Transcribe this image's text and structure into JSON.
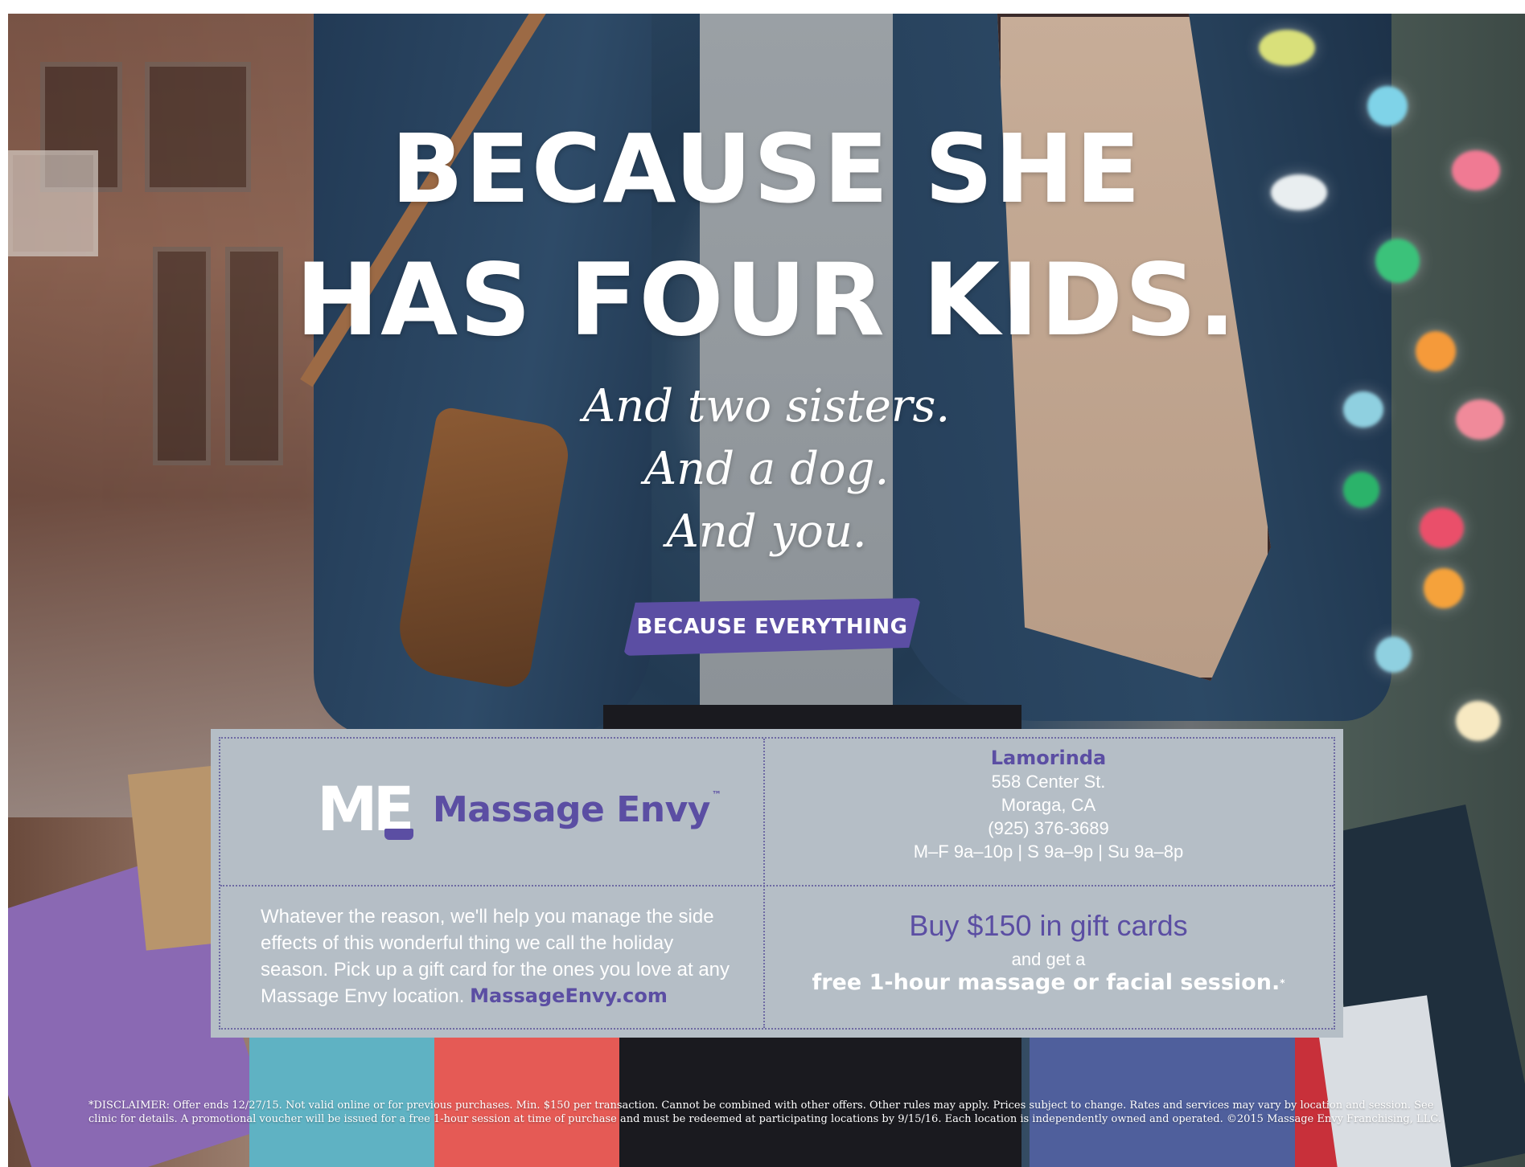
{
  "headline": {
    "line1": "BECAUSE SHE",
    "line2": "HAS FOUR KIDS."
  },
  "subhead": {
    "line1": "And two sisters.",
    "line2": "And a dog.",
    "line3": "And you."
  },
  "banner": {
    "text": "BECAUSE EVERYTHING"
  },
  "logo": {
    "mark": "ME",
    "brand": "Massage Envy",
    "trademark": "™"
  },
  "location": {
    "name": "Lamorinda",
    "street": "558 Center St.",
    "city": "Moraga, CA",
    "phone": "(925) 376-3689",
    "hours": "M–F 9a–10p | S 9a–9p | Su 9a–8p"
  },
  "description": {
    "text": "Whatever the reason, we'll help you manage the side effects of this wonderful thing we call the holiday season. Pick up a gift card for the ones you love at any Massage Envy location.",
    "link": "MassageEnvy.com"
  },
  "offer": {
    "headline": "Buy $150 in gift cards",
    "connector": "and get a",
    "reward": "free 1-hour massage or facial session.",
    "asterisk": "*"
  },
  "disclaimer": {
    "text": "*DISCLAIMER: Offer ends 12/27/15. Not valid online or for previous purchases. Min. $150 per transaction. Cannot be combined with other offers. Other rules may apply. Prices subject to change. Rates and services may vary by location and session. See clinic for details. A promotional voucher will be issued for a free 1-hour session at time of purchase and must be redeemed at participating locations by 9/15/16. Each location is independently owned and operated. ©2015 Massage Envy Franchising, LLC."
  },
  "colors": {
    "brand_purple": "#5b4ea3",
    "panel_gray": "#b5bec6",
    "text_white": "#ffffff"
  }
}
